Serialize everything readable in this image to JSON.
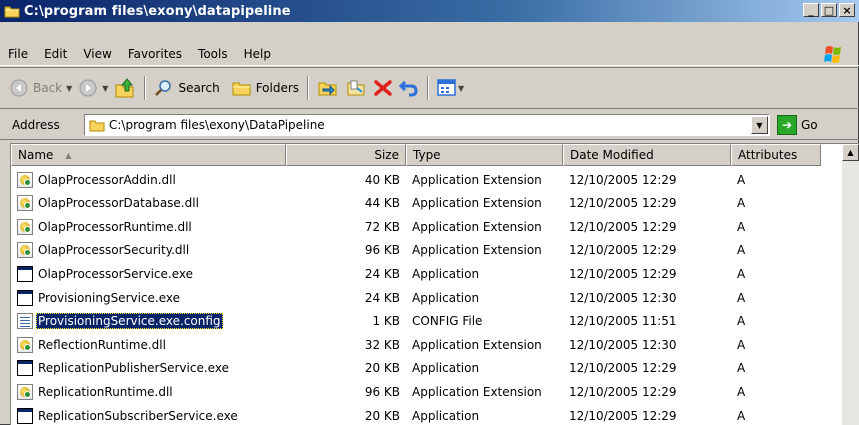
{
  "window": {
    "title": "C:\\program files\\exony\\datapipeline",
    "minimize": "_",
    "maximize": "□",
    "close": "×"
  },
  "menu": [
    {
      "label": "File"
    },
    {
      "label": "Edit"
    },
    {
      "label": "View"
    },
    {
      "label": "Favorites"
    },
    {
      "label": "Tools"
    },
    {
      "label": "Help"
    }
  ],
  "toolbar": {
    "back_label": "Back",
    "search_label": "Search",
    "folders_label": "Folders"
  },
  "address": {
    "label": "Address",
    "value": "C:\\program files\\exony\\DataPipeline",
    "go_label": "Go"
  },
  "columns": {
    "name": "Name",
    "size": "Size",
    "type": "Type",
    "date": "Date Modified",
    "attributes": "Attributes"
  },
  "files": [
    {
      "name": "OlapProcessorAddin.dll",
      "size": "40 KB",
      "type": "Application Extension",
      "date": "12/10/2005 12:29",
      "attr": "A",
      "icon": "dll"
    },
    {
      "name": "OlapProcessorDatabase.dll",
      "size": "44 KB",
      "type": "Application Extension",
      "date": "12/10/2005 12:29",
      "attr": "A",
      "icon": "dll"
    },
    {
      "name": "OlapProcessorRuntime.dll",
      "size": "72 KB",
      "type": "Application Extension",
      "date": "12/10/2005 12:29",
      "attr": "A",
      "icon": "dll"
    },
    {
      "name": "OlapProcessorSecurity.dll",
      "size": "96 KB",
      "type": "Application Extension",
      "date": "12/10/2005 12:29",
      "attr": "A",
      "icon": "dll"
    },
    {
      "name": "OlapProcessorService.exe",
      "size": "24 KB",
      "type": "Application",
      "date": "12/10/2005 12:29",
      "attr": "A",
      "icon": "exe"
    },
    {
      "name": "ProvisioningService.exe",
      "size": "24 KB",
      "type": "Application",
      "date": "12/10/2005 12:30",
      "attr": "A",
      "icon": "exe"
    },
    {
      "name": "ProvisioningService.exe.config",
      "size": "1 KB",
      "type": "CONFIG File",
      "date": "12/10/2005 11:51",
      "attr": "A",
      "icon": "cfg",
      "selected": true
    },
    {
      "name": "ReflectionRuntime.dll",
      "size": "32 KB",
      "type": "Application Extension",
      "date": "12/10/2005 12:30",
      "attr": "A",
      "icon": "dll"
    },
    {
      "name": "ReplicationPublisherService.exe",
      "size": "20 KB",
      "type": "Application",
      "date": "12/10/2005 12:29",
      "attr": "A",
      "icon": "exe"
    },
    {
      "name": "ReplicationRuntime.dll",
      "size": "96 KB",
      "type": "Application Extension",
      "date": "12/10/2005 12:29",
      "attr": "A",
      "icon": "dll"
    },
    {
      "name": "ReplicationSubscriberService.exe",
      "size": "20 KB",
      "type": "Application",
      "date": "12/10/2005 12:29",
      "attr": "A",
      "icon": "exe"
    }
  ]
}
